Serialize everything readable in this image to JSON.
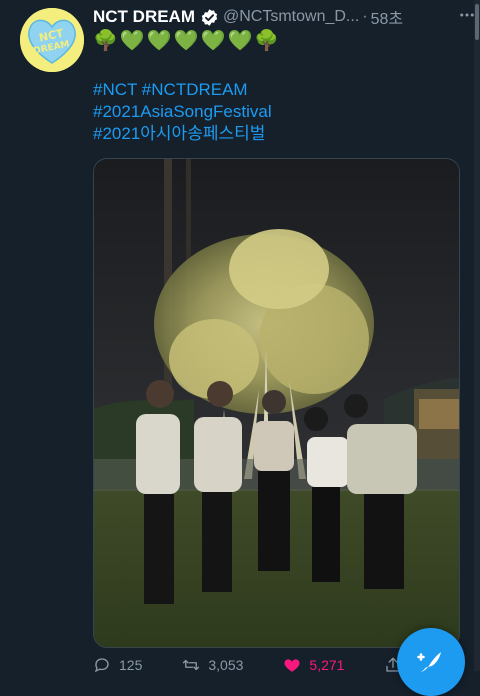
{
  "tweet": {
    "display_name": "NCT DREAM",
    "handle": "@NCTsmtown_D...",
    "separator": "·",
    "time": "58초",
    "emoji_line": "🌳💚💚💚💚💚🌳",
    "hashtags": [
      "#NCT #NCTDREAM",
      "#2021AsiaSongFestival",
      "#2021아시아송페스티벌"
    ],
    "avatar_text": "NCT DREAM",
    "actions": {
      "reply_count": "125",
      "retweet_count": "3,053",
      "like_count": "5,271"
    }
  },
  "icons": {
    "verified": "verified-badge-icon",
    "more": "more-options-icon",
    "reply": "reply-icon",
    "retweet": "retweet-icon",
    "like": "heart-icon",
    "share": "share-icon",
    "compose": "compose-tweet-icon"
  },
  "colors": {
    "background": "#15202b",
    "link": "#1d9bf0",
    "muted": "#8b98a5",
    "like": "#f91880",
    "avatar_bg": "#f3ee7d",
    "avatar_logo": "#8fd3f0"
  }
}
